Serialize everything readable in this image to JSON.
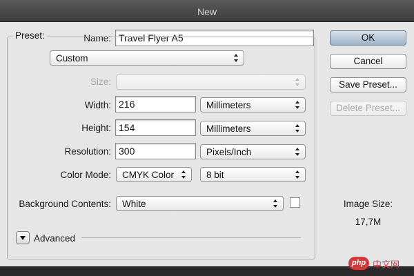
{
  "window": {
    "title": "New"
  },
  "form": {
    "name_label": "Name:",
    "name_value": "Travel Flyer A5",
    "preset_label": "Preset:",
    "preset_value": "Custom",
    "size_label": "Size:",
    "size_value": "",
    "width_label": "Width:",
    "width_value": "216",
    "width_unit": "Millimeters",
    "height_label": "Height:",
    "height_value": "154",
    "height_unit": "Millimeters",
    "resolution_label": "Resolution:",
    "resolution_value": "300",
    "resolution_unit": "Pixels/Inch",
    "colormode_label": "Color Mode:",
    "colormode_value": "CMYK Color",
    "bitdepth_value": "8 bit",
    "background_label": "Background Contents:",
    "background_value": "White",
    "background_color_swatch": "#ffffff",
    "advanced_label": "Advanced"
  },
  "buttons": {
    "ok": "OK",
    "cancel": "Cancel",
    "save_preset": "Save Preset...",
    "delete_preset": "Delete Preset..."
  },
  "image_size": {
    "label": "Image Size:",
    "value": "17,7M"
  },
  "watermark": {
    "logo": "php",
    "text": "中文网"
  },
  "colors": {
    "primary_button": "#9eb1c6",
    "dialog_bg": "#e6e6e6",
    "watermark": "#d23b3b"
  }
}
